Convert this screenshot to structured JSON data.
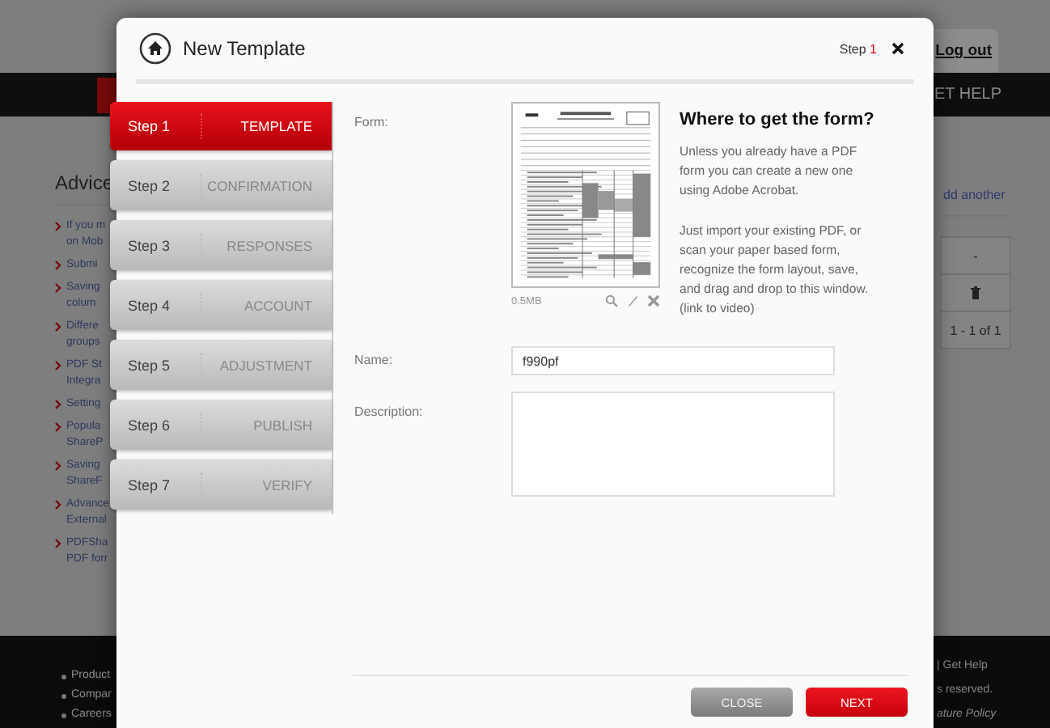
{
  "background": {
    "logout": "Log out",
    "nav_text": "ET HELP",
    "heading": "Advice",
    "advice_links": [
      [
        "If you m",
        "on Mob"
      ],
      [
        "Submi"
      ],
      [
        "Saving",
        "colum"
      ],
      [
        "Differe",
        "groups"
      ],
      [
        "PDF St",
        "Integra"
      ],
      [
        "Setting"
      ],
      [
        "Popula",
        "ShareP"
      ],
      [
        "Saving",
        "ShareF"
      ],
      [
        "Advance",
        "External"
      ],
      [
        "PDFSha",
        "PDF forr"
      ]
    ],
    "add_link": "dd another",
    "table": {
      "cell": "-",
      "pager": "1 - 1 of 1"
    },
    "footer_links": [
      "Product",
      "Compar",
      "Careers"
    ],
    "footer_right": [
      "| Get Help",
      "s reserved.",
      "ature Policy"
    ]
  },
  "dialog": {
    "title": "New Template",
    "step_indicator": {
      "label": "Step",
      "number": "1"
    },
    "steps": [
      {
        "step": "Step 1",
        "label": "TEMPLATE",
        "selected": true
      },
      {
        "step": "Step 2",
        "label": "CONFIRMATION",
        "selected": false
      },
      {
        "step": "Step 3",
        "label": "RESPONSES",
        "selected": false
      },
      {
        "step": "Step 4",
        "label": "ACCOUNT",
        "selected": false
      },
      {
        "step": "Step 5",
        "label": "ADJUSTMENT",
        "selected": false
      },
      {
        "step": "Step 6",
        "label": "PUBLISH",
        "selected": false
      },
      {
        "step": "Step 7",
        "label": "VERIFY",
        "selected": false
      }
    ],
    "form_label": "Form:",
    "file_size": "0.5MB",
    "help": {
      "heading": "Where to get the form?",
      "paragraphs": [
        "Unless you already have a PDF form you can create a new one using Adobe Acrobat.",
        "Just import your existing PDF, or scan your paper based form, recognize the form layout, save, and drag and drop to this window. (link to video)"
      ]
    },
    "name": {
      "label": "Name:",
      "value": "f990pf"
    },
    "description": {
      "label": "Description:"
    },
    "buttons": [
      {
        "label": "CLOSE",
        "kind": "secondary"
      },
      {
        "label": "NEXT",
        "kind": "primary"
      }
    ]
  }
}
